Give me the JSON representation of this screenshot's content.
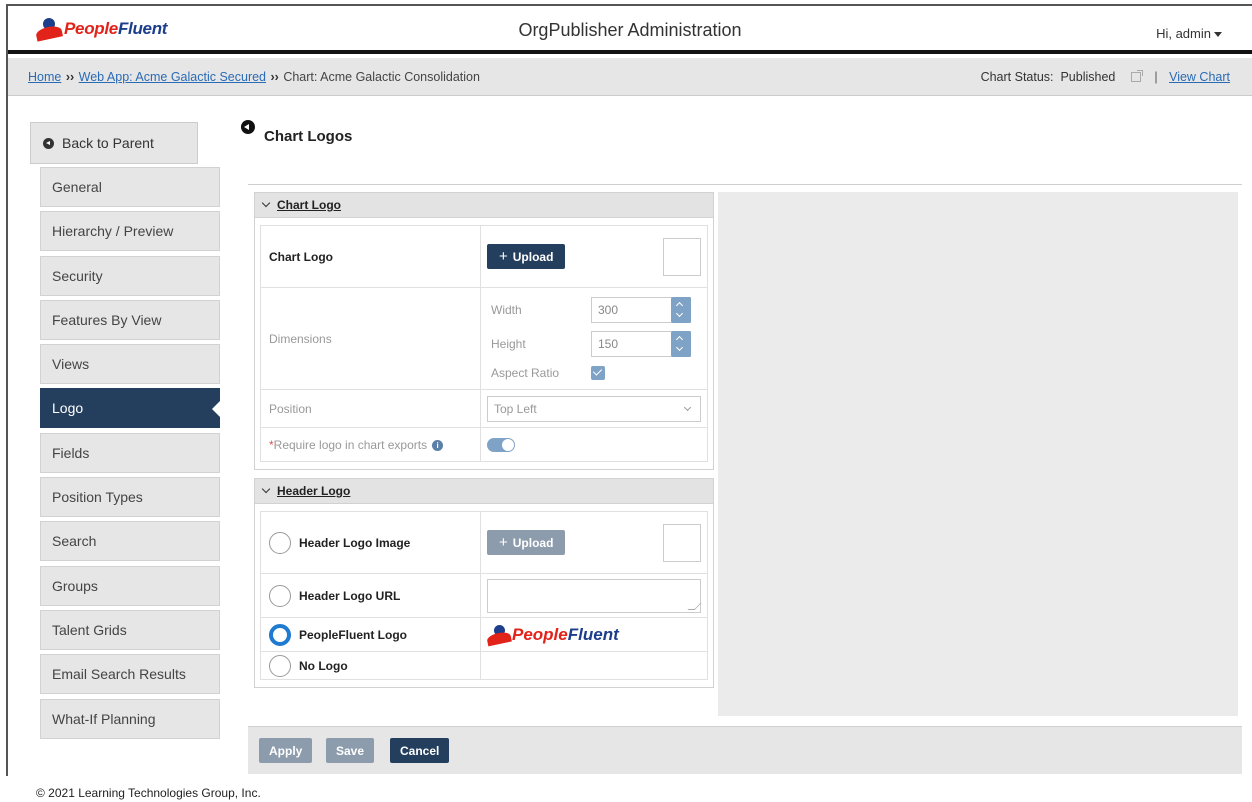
{
  "header": {
    "brand_people": "People",
    "brand_fluent": "Fluent",
    "app_title": "OrgPublisher Administration",
    "user_greeting": "Hi,  admin"
  },
  "breadcrumb": {
    "home": "Home",
    "sep": "››",
    "webapp": "Web App: Acme Galactic Secured",
    "chart_prefix": "Chart",
    "chart_name": ": Acme Galactic Consolidation",
    "status_label": "Chart Status:",
    "status_value": "Published",
    "pipe": "|",
    "view_chart": "View Chart"
  },
  "sidebar": {
    "back": "Back to Parent",
    "items": [
      {
        "label": "General"
      },
      {
        "label": "Hierarchy / Preview"
      },
      {
        "label": "Security"
      },
      {
        "label": "Features By View"
      },
      {
        "label": "Views"
      },
      {
        "label": "Logo",
        "active": true
      },
      {
        "label": "Fields"
      },
      {
        "label": "Position Types"
      },
      {
        "label": "Search"
      },
      {
        "label": "Groups"
      },
      {
        "label": "Talent Grids"
      },
      {
        "label": "Email Search Results"
      },
      {
        "label": "What-If Planning"
      }
    ]
  },
  "page": {
    "title": "Chart Logos"
  },
  "chart_logo_section": {
    "heading": "Chart Logo",
    "chart_logo_label": "Chart Logo",
    "upload_label": "Upload",
    "upload_plus": "+",
    "dimensions_label": "Dimensions",
    "width_label": "Width",
    "width_value": "300",
    "height_label": "Height",
    "height_value": "150",
    "aspect_ratio_label": "Aspect Ratio",
    "aspect_ratio_checked": true,
    "position_label": "Position",
    "position_value": "Top Left",
    "require_asterisk": "*",
    "require_label": "Require logo in chart exports",
    "require_info": "i",
    "require_enabled": true
  },
  "header_logo_section": {
    "heading": "Header Logo",
    "options": {
      "image": "Header Logo Image",
      "url": "Header Logo URL",
      "peoplefluent": "PeopleFluent Logo",
      "none": "No Logo"
    },
    "selected": "peoplefluent",
    "upload_label": "Upload",
    "upload_plus": "+",
    "url_value": ""
  },
  "actions": {
    "apply": "Apply",
    "save": "Save",
    "cancel": "Cancel"
  },
  "footer": {
    "copyright": "© 2021 Learning Technologies Group, Inc."
  },
  "colors": {
    "navy": "#243f5e",
    "brand_red": "#e2231a",
    "brand_blue": "#1d3e8a",
    "link": "#2a6bb5",
    "radio_selected": "#1f7ad0"
  }
}
